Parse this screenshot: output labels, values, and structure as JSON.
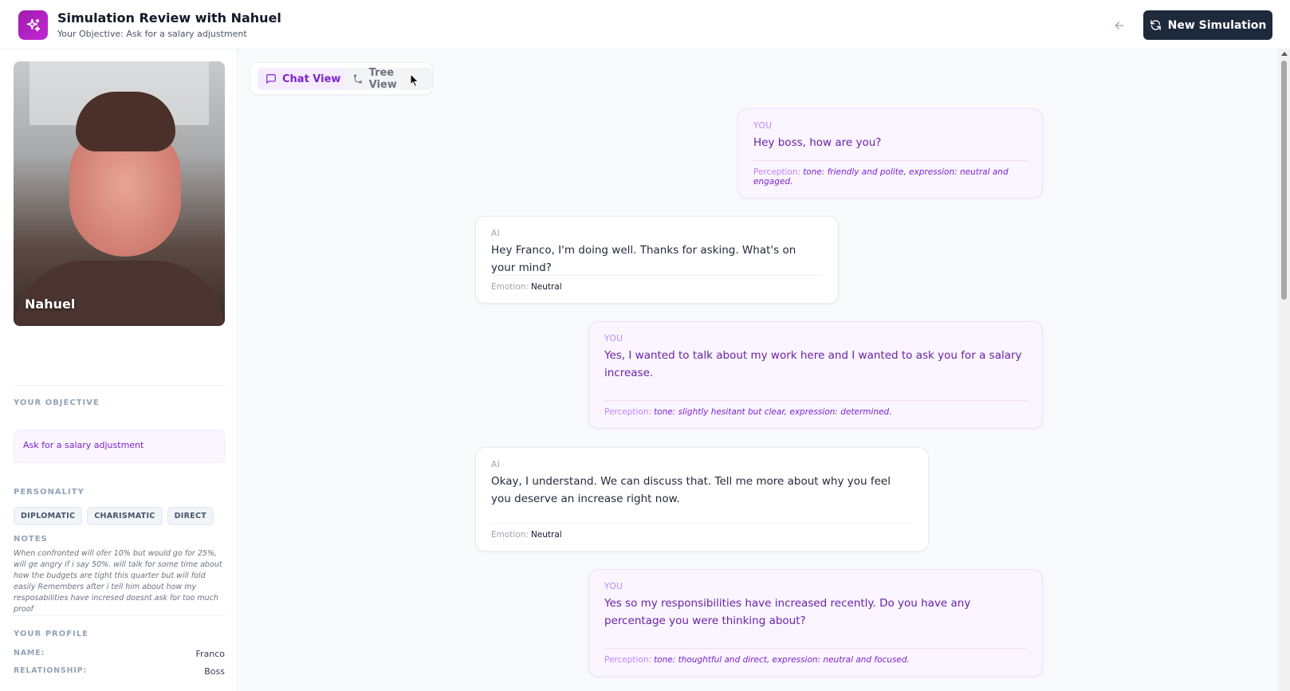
{
  "header": {
    "title": "Simulation Review with Nahuel",
    "subtitle": "Your Objective: Ask for a salary adjustment",
    "new_simulation_label": "New Simulation"
  },
  "sidebar": {
    "persona_name": "Nahuel",
    "objective_label": "YOUR OBJECTIVE",
    "objective_text": "Ask for a salary adjustment",
    "personality_label": "PERSONALITY",
    "personality_tags": [
      "DIPLOMATIC",
      "CHARISMATIC",
      "DIRECT"
    ],
    "notes_label": "NOTES",
    "notes_text": "When confronted will ofer 10% but would go for 25%, will ge angry if i say 50%. will talk for some time about how the budgets are tight this quarter but will fold easily Remembers after i tell him about how my resposabilities have incresed doesnt ask for too much proof",
    "profile_label": "YOUR PROFILE",
    "profile": [
      {
        "key": "NAME:",
        "value": "Franco"
      },
      {
        "key": "RELATIONSHIP:",
        "value": "Boss"
      }
    ]
  },
  "view_toggle": {
    "chat_view": "Chat View",
    "tree_view": "Tree View",
    "active": "chat"
  },
  "messages": [
    {
      "role": "you",
      "speaker": "YOU",
      "text": "Hey boss, how are you?",
      "meta_key": "Perception:",
      "meta_value": "tone: friendly and polite, expression: neutral and engaged."
    },
    {
      "role": "ai",
      "speaker": "AI",
      "text": "Hey Franco, I'm doing well. Thanks for asking. What's on your mind?",
      "meta_key": "Emotion:",
      "meta_value": "Neutral"
    },
    {
      "role": "you",
      "speaker": "YOU",
      "text": "Yes, I wanted to talk about my work here and I wanted to ask you for a salary increase.",
      "meta_key": "Perception:",
      "meta_value": "tone: slightly hesitant but clear, expression: determined."
    },
    {
      "role": "ai",
      "speaker": "AI",
      "text": "Okay, I understand. We can discuss that. Tell me more about why you feel you deserve an increase right now.",
      "meta_key": "Emotion:",
      "meta_value": "Neutral"
    },
    {
      "role": "you",
      "speaker": "YOU",
      "text": "Yes so my responsibilities have increased recently. Do you have any percentage you were thinking about?",
      "meta_key": "Perception:",
      "meta_value": "tone: thoughtful and direct, expression: neutral and focused."
    }
  ],
  "colors": {
    "accent": "#7e22ce",
    "brand_gradient_start": "#a21caf",
    "button_dark": "#1e293b"
  }
}
